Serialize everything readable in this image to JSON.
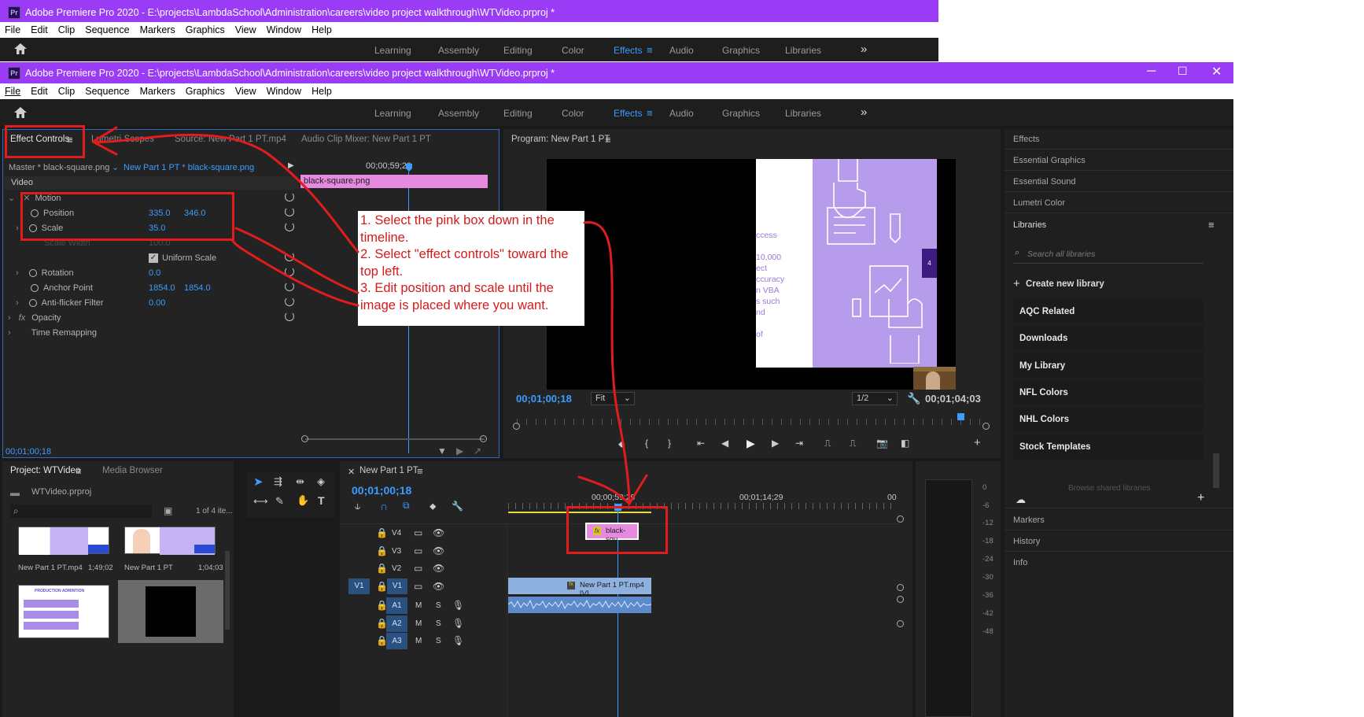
{
  "app_title": "Adobe Premiere Pro 2020 - E:\\projects\\LambdaSchool\\Administration\\careers\\video project walkthrough\\WTVideo.prproj *",
  "menu": [
    "File",
    "Edit",
    "Clip",
    "Sequence",
    "Markers",
    "Graphics",
    "View",
    "Window",
    "Help"
  ],
  "workspaces": [
    "Learning",
    "Assembly",
    "Editing",
    "Color",
    "Effects",
    "Audio",
    "Graphics",
    "Libraries"
  ],
  "workspace_active": "Effects",
  "more_icon": "»",
  "panel_tabs": {
    "effect_controls": "Effect Controls",
    "lumetri_scopes": "Lumetri Scopes",
    "source": "Source: New Part 1 PT.mp4",
    "audio_mixer": "Audio Clip Mixer: New Part 1 PT"
  },
  "effect_controls": {
    "master": "Master * black-square.png",
    "sequence_clip": "New Part 1 PT * black-square.png",
    "time_ruler": "00;00;59;29",
    "clip_label": "black-square.png",
    "section_video": "Video",
    "motion": "Motion",
    "position": {
      "label": "Position",
      "x": "335.0",
      "y": "346.0"
    },
    "scale": {
      "label": "Scale",
      "value": "35.0"
    },
    "scale_width": {
      "label": "Scale Width",
      "value": "100.0"
    },
    "uniform_scale": "Uniform Scale",
    "rotation": {
      "label": "Rotation",
      "value": "0.0"
    },
    "anchor": {
      "label": "Anchor Point",
      "x": "1854.0",
      "y": "1854.0"
    },
    "antiflicker": {
      "label": "Anti-flicker Filter",
      "value": "0.00"
    },
    "opacity": "Opacity",
    "time_remap": "Time Remapping",
    "fx": "fx",
    "timecode": "00;01;00;18"
  },
  "instructions": {
    "line1": "1. Select the pink box down in the timeline.",
    "line2": "2. Select \"effect controls\" toward the top left.",
    "line3": "3. Edit position and scale until the image is placed where you want."
  },
  "program": {
    "title": "Program: New Part 1 PT",
    "timecode_left": "00;01;00;18",
    "fit": "Fit",
    "resolution": "1/2",
    "timecode_right": "00;01;04;03",
    "frame_texts": [
      "ccess",
      "10,000",
      "ect",
      "ccuracy",
      "n VBA",
      "s such",
      "nd",
      "of"
    ],
    "side_tab": "4"
  },
  "right_panel": {
    "effects": "Effects",
    "essential_graphics": "Essential Graphics",
    "essential_sound": "Essential Sound",
    "lumetri_color": "Lumetri Color",
    "libraries": "Libraries",
    "search_placeholder": "Search all libraries",
    "create_library": "Create new library",
    "library_items": [
      "AQC Related",
      "Downloads",
      "My Library",
      "NFL Colors",
      "NHL Colors",
      "Stock Templates"
    ],
    "browse_shared": "Browse shared libraries",
    "markers": "Markers",
    "history": "History",
    "info": "Info"
  },
  "project": {
    "tab": "Project: WTVideo",
    "media_browser": "Media Browser",
    "file": "WTVideo.prproj",
    "count": "1 of 4 ite...",
    "items": [
      {
        "name": "New Part 1 PT.mp4",
        "duration": "1;49;02"
      },
      {
        "name": "New Part 1 PT",
        "duration": "1;04;03"
      }
    ],
    "thumb_caption": "PRODUCTION ADMINTION"
  },
  "timeline": {
    "title": "New Part 1 PT",
    "timecode": "00;01;00;18",
    "ruler": [
      "00;00;59;29",
      "00;01;14;29",
      "00"
    ],
    "tracks_video": [
      "V4",
      "V3",
      "V2",
      "V1"
    ],
    "tracks_audio": [
      "A1",
      "A2",
      "A3"
    ],
    "v1_source": "V1",
    "clip_graphic": "black-squ",
    "clip_video": "New Part 1 PT.mp4 [V]",
    "mute": "M",
    "solo": "S",
    "fx": "fx"
  },
  "audio_meter": [
    "0",
    "-6",
    "-12",
    "-18",
    "-24",
    "-30",
    "-36",
    "-42",
    "-48"
  ],
  "colors": {
    "titlebar": "#9a3cf5",
    "accent": "#3a9dff",
    "annotation_red": "#e01c1c",
    "clip_pink": "#e68ae0"
  }
}
